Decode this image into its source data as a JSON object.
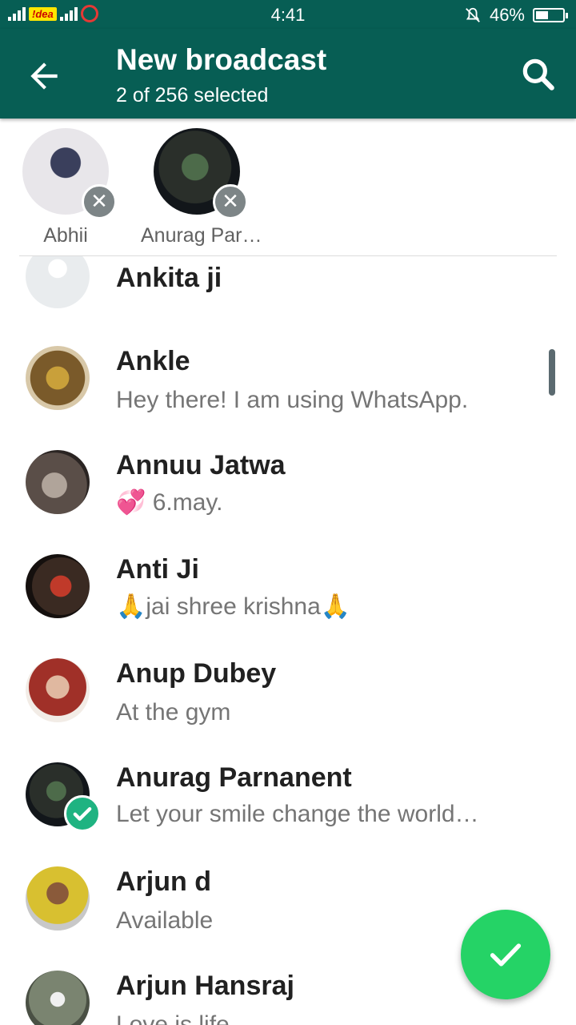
{
  "status_bar": {
    "carrier": "!dea",
    "time": "4:41",
    "battery": "46%",
    "battery_level": 0.46,
    "icons": [
      "signal-icon",
      "signal-icon",
      "carrier-logo-icon",
      "mute-bell-icon",
      "battery-icon"
    ]
  },
  "header": {
    "title": "New broadcast",
    "subtitle": "2 of 256 selected",
    "back_icon": "arrow-left-icon",
    "search_icon": "search-icon"
  },
  "selected": [
    {
      "name": "Abhii"
    },
    {
      "name": "Anurag Par…"
    }
  ],
  "contacts": [
    {
      "name": "Ankita ji",
      "status": ""
    },
    {
      "name": "Ankle",
      "status": "Hey there! I am using WhatsApp."
    },
    {
      "name": "Annuu Jatwa",
      "status": "💞 6.may."
    },
    {
      "name": "Anti Ji",
      "status": "🙏jai shree krishna🙏"
    },
    {
      "name": "Anup Dubey",
      "status": "At the gym"
    },
    {
      "name": "Anurag Parnanent",
      "status": "Let your smile change the world…",
      "selected": true
    },
    {
      "name": "Arjun d",
      "status": "Available"
    },
    {
      "name": "Arjun Hansraj",
      "status": "Love is life"
    }
  ],
  "fab": {
    "icon": "check-icon"
  },
  "colors": {
    "primary": "#075e54",
    "accent": "#25d366",
    "check": "#1fb381"
  }
}
